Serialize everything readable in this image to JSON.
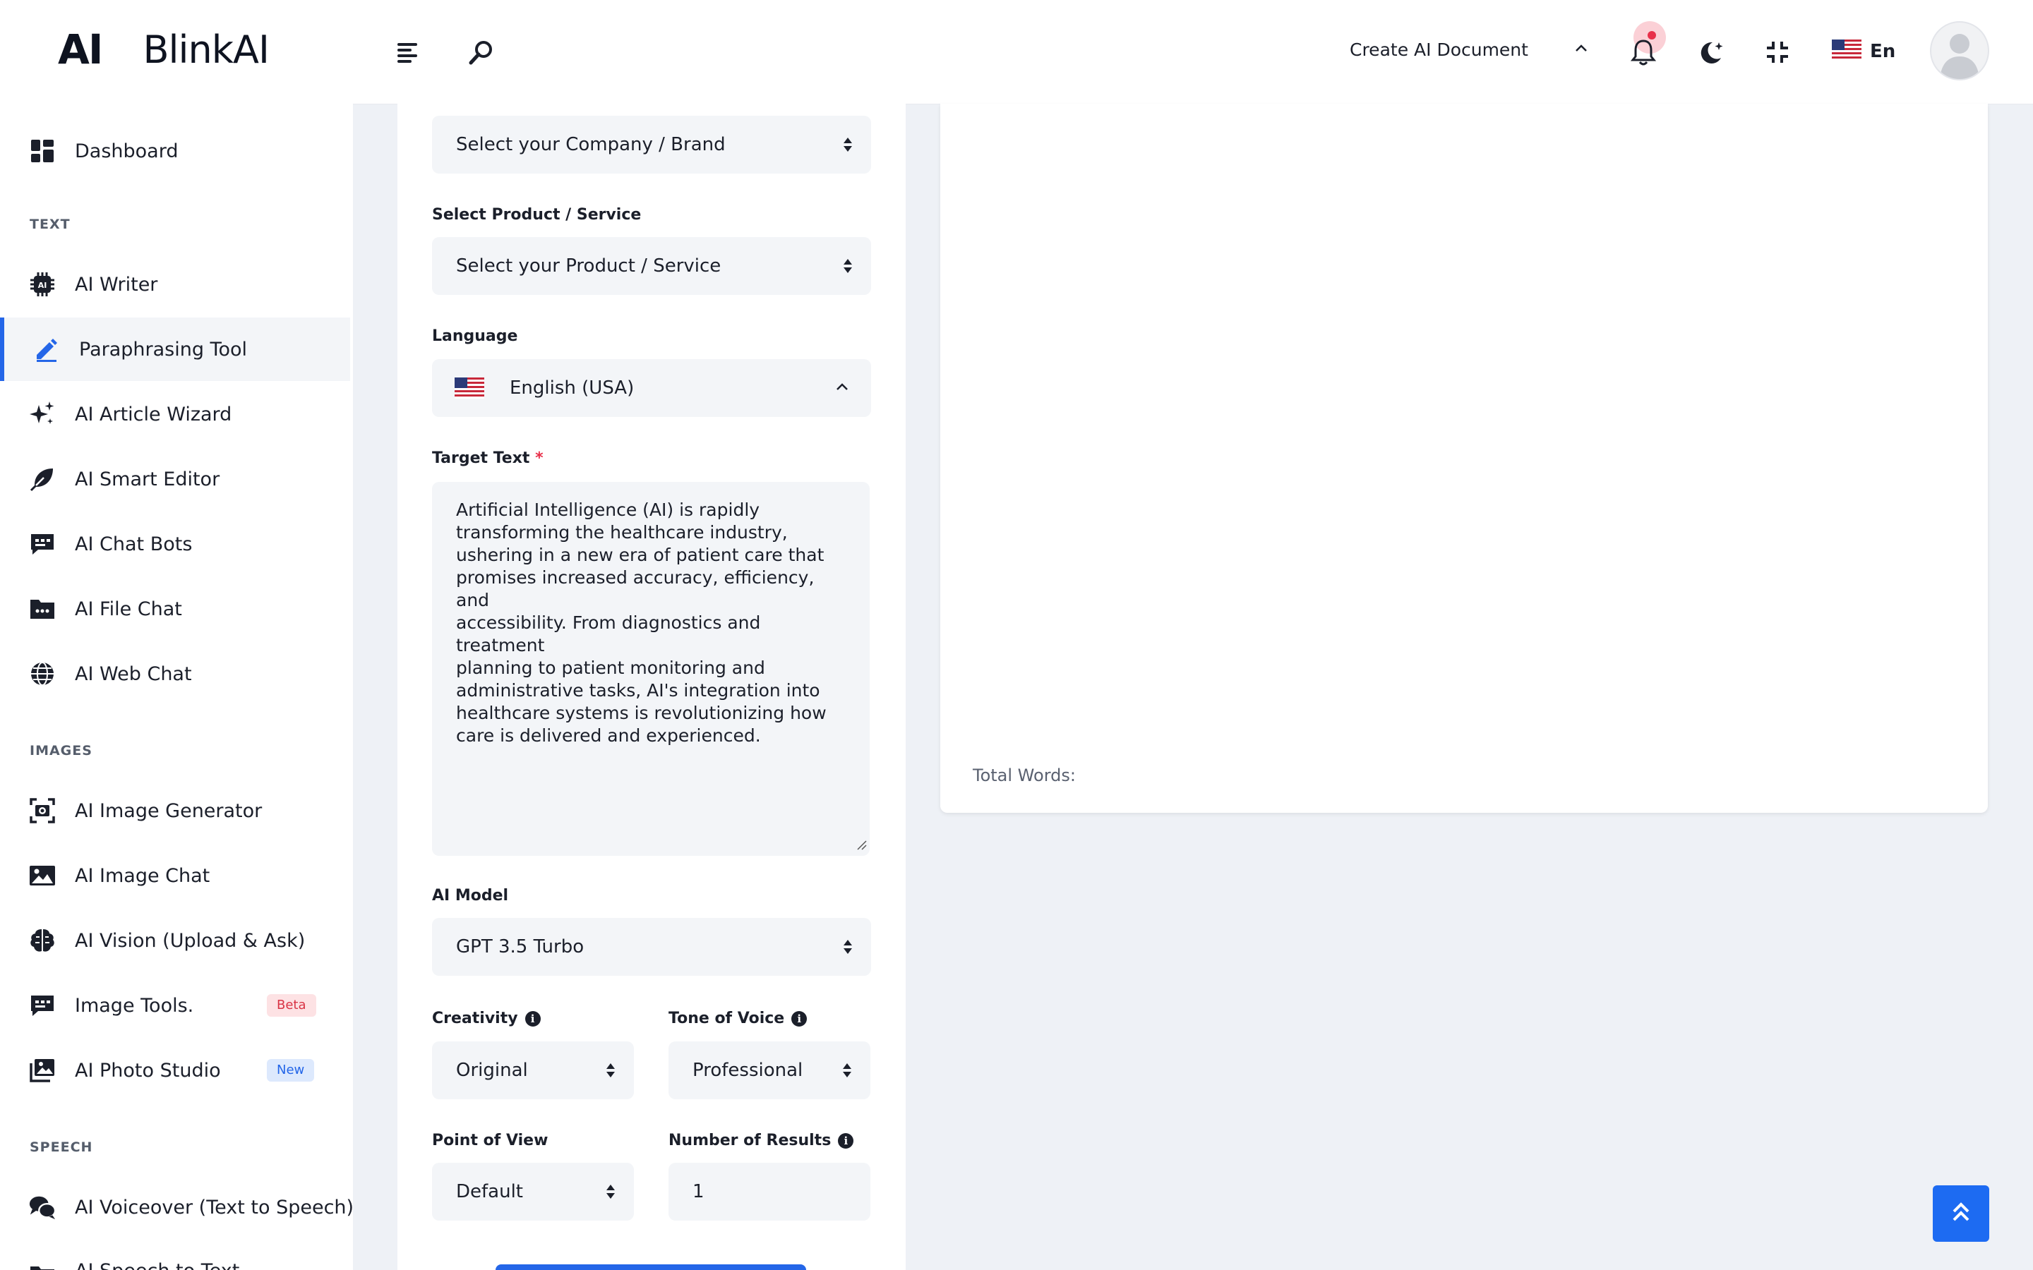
{
  "header": {
    "logo_mark": "AI",
    "logo_text": "BlinkAI",
    "create_doc": "Create AI Document",
    "language_short": "En"
  },
  "sidebar": {
    "dashboard": "Dashboard",
    "sections": {
      "text": "TEXT",
      "images": "IMAGES",
      "speech": "SPEECH"
    },
    "text_items": [
      {
        "label": "AI Writer",
        "icon": "ai-chip-icon"
      },
      {
        "label": "Paraphrasing Tool",
        "icon": "pencil-icon",
        "active": true
      },
      {
        "label": "AI Article Wizard",
        "icon": "sparkles-icon"
      },
      {
        "label": "AI Smart Editor",
        "icon": "feather-icon"
      },
      {
        "label": "AI Chat Bots",
        "icon": "chat-icon"
      },
      {
        "label": "AI File Chat",
        "icon": "folder-icon"
      },
      {
        "label": "AI Web Chat",
        "icon": "globe-icon"
      }
    ],
    "image_items": [
      {
        "label": "AI Image Generator",
        "icon": "camera-frame-icon"
      },
      {
        "label": "AI Image Chat",
        "icon": "image-icon"
      },
      {
        "label": "AI Vision (Upload & Ask)",
        "icon": "brain-icon"
      },
      {
        "label": "Image Tools.",
        "icon": "chat-icon",
        "badge": "Beta"
      },
      {
        "label": "AI Photo Studio",
        "icon": "photos-icon",
        "badge": "New"
      }
    ],
    "speech_items": [
      {
        "label": "AI Voiceover (Text to Speech)",
        "icon": "comments-icon"
      },
      {
        "label": "AI Speech to Text",
        "icon": "folder-icon"
      }
    ]
  },
  "form": {
    "company_placeholder": "Select your Company / Brand",
    "product_label": "Select Product / Service",
    "product_placeholder": "Select your Product / Service",
    "language_label": "Language",
    "language_value": "English (USA)",
    "target_label": "Target Text",
    "target_required": "*",
    "target_text": "Artificial Intelligence (AI) is rapidly\ntransforming the healthcare industry,\nushering in a new era of patient care that\npromises increased accuracy, efficiency, and\naccessibility. From diagnostics and treatment\nplanning to patient monitoring and\nadministrative tasks, AI's integration into\nhealthcare systems is revolutionizing how\ncare is delivered and experienced.",
    "model_label": "AI Model",
    "model_value": "GPT 3.5 Turbo",
    "creativity_label": "Creativity",
    "creativity_value": "Original",
    "tone_label": "Tone of Voice",
    "tone_value": "Professional",
    "pov_label": "Point of View",
    "pov_value": "Default",
    "results_label": "Number of Results",
    "results_value": "1"
  },
  "output": {
    "total_words_label": "Total Words:"
  },
  "colors": {
    "accent": "#2466e8",
    "required": "#e8304a",
    "background": "#eef1f6"
  }
}
